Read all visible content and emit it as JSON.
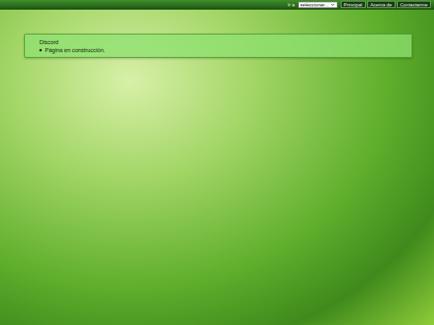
{
  "topbar": {
    "goto_label": "Ir a",
    "select": {
      "value": "seleccionar..."
    },
    "buttons": [
      {
        "label": "Principal"
      },
      {
        "label": "Acerca de"
      },
      {
        "label": "Contactarme"
      }
    ]
  },
  "panel": {
    "title": "Discord",
    "items": [
      "Página en construcción."
    ]
  }
}
